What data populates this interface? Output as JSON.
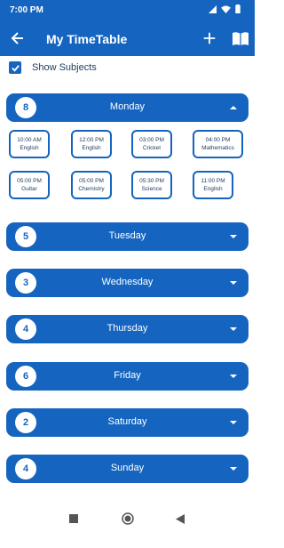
{
  "status": {
    "time": "7:00 PM"
  },
  "appbar": {
    "title": "My TimeTable"
  },
  "show_subjects": {
    "label": "Show Subjects",
    "checked": true
  },
  "days": [
    {
      "count": "8",
      "name": "Monday",
      "expanded": true
    },
    {
      "count": "5",
      "name": "Tuesday",
      "expanded": false
    },
    {
      "count": "3",
      "name": "Wednesday",
      "expanded": false
    },
    {
      "count": "4",
      "name": "Thursday",
      "expanded": false
    },
    {
      "count": "6",
      "name": "Friday",
      "expanded": false
    },
    {
      "count": "2",
      "name": "Saturday",
      "expanded": false
    },
    {
      "count": "4",
      "name": "Sunday",
      "expanded": false
    }
  ],
  "monday_slots": [
    {
      "time": "10:00 AM",
      "subject": "English"
    },
    {
      "time": "12:00 PM",
      "subject": "English"
    },
    {
      "time": "03:00 PM",
      "subject": "Cricket"
    },
    {
      "time": "04:00 PM",
      "subject": "Mathematics"
    },
    {
      "time": "05:00 PM",
      "subject": "Guitar"
    },
    {
      "time": "05:00 PM",
      "subject": "Chemistry"
    },
    {
      "time": "05:30 PM",
      "subject": "Science"
    },
    {
      "time": "11:00 PM",
      "subject": "English"
    }
  ],
  "colors": {
    "primary": "#1565c0",
    "text_dark": "#1e3a5f"
  }
}
